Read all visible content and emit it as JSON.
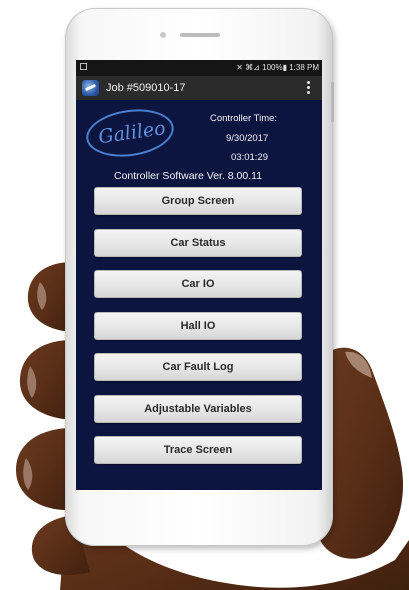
{
  "status_bar": {
    "indicators": "✕ ⌘⊿ 100%▮ 1:38 PM"
  },
  "app_bar": {
    "title": "Job #509010-17",
    "app_icon": "galileo-app-icon",
    "menu_icon": "overflow-menu-icon"
  },
  "logo_text": "Galileo",
  "controller": {
    "time_label": "Controller Time:",
    "date": "9/30/2017",
    "time": "03:01:29",
    "software_version": "Controller Software Ver. 8.00.11"
  },
  "menu_buttons": [
    "Group Screen",
    "Car Status",
    "Car IO",
    "Hall IO",
    "Car Fault Log",
    "Adjustable Variables",
    "Trace Screen"
  ],
  "colors": {
    "screen_background": "#0c1540",
    "button_face": "#e6e6e6",
    "logo_blue": "#4a7fd0"
  }
}
